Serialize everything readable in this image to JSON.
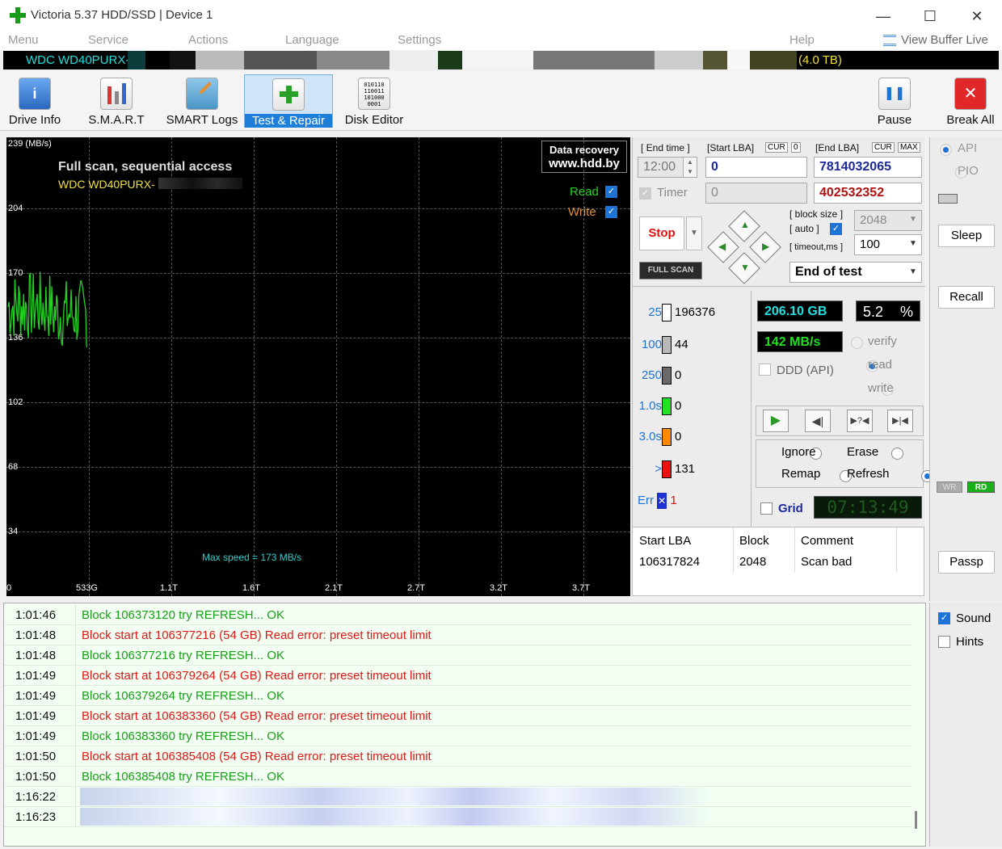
{
  "window": {
    "title": "Victoria 5.37 HDD/SSD | Device 1",
    "minimize": "—",
    "maximize": "☐",
    "close": "✕"
  },
  "menu": {
    "items": [
      "Menu",
      "Service",
      "Actions",
      "Language",
      "Settings",
      "Help"
    ],
    "view_buffer": "View Buffer Live"
  },
  "drive": {
    "name": "WDC WD40PURX-",
    "capacity": "(4.0 TB)"
  },
  "toolbar": {
    "drive_info": "Drive Info",
    "smart": "S.M.A.R.T",
    "smart_logs": "SMART Logs",
    "test_repair": "Test & Repair",
    "disk_editor": "Disk Editor",
    "pause": "Pause",
    "break_all": "Break All",
    "disk_editor_icon_text": "010110 110011 101000 0001"
  },
  "graph": {
    "y_unit": "239 (MB/s)",
    "y_ticks": [
      "204",
      "170",
      "136",
      "102",
      "68",
      "34"
    ],
    "x_ticks": [
      "0",
      "533G",
      "1.1T",
      "1.6T",
      "2.1T",
      "2.7T",
      "3.2T",
      "3.7T"
    ],
    "title": "Full scan, sequential access",
    "drive": "WDC WD40PURX-",
    "brand_line1": "Data recovery",
    "brand_line2": "www.hdd.by",
    "read_label": "Read",
    "write_label": "Write",
    "max_speed": "Max speed = 173 MB/s",
    "read_color": "#22d422",
    "write_color": "#e09040"
  },
  "controls": {
    "end_time_label": "[ End time ]",
    "start_lba_label": "[Start LBA]",
    "end_lba_label": "[End LBA]",
    "cur_tag": "CUR",
    "max_tag": "MAX",
    "start_cur_value": "0",
    "end_time": "12:00",
    "start_lba": "0",
    "end_lba": "7814032065",
    "timer_label": "Timer",
    "timer_value": "0",
    "current_lba": "402532352",
    "stop": "Stop",
    "full_scan": "FULL SCAN",
    "block_size_label": "[ block size ]",
    "auto_label": "[ auto ]",
    "timeout_label": "[ timeout,ms ]",
    "block_size": "2048",
    "timeout": "100",
    "end_action": "End of test"
  },
  "stats": {
    "rows": [
      {
        "label": "25",
        "count": "196376",
        "color": "#ffffff"
      },
      {
        "label": "100",
        "count": "44",
        "color": "#b8b8b8"
      },
      {
        "label": "250",
        "count": "0",
        "color": "#6a6a6a"
      },
      {
        "label": "1.0s",
        "count": "0",
        "color": "#22e022"
      },
      {
        "label": "3.0s",
        "count": "0",
        "color": "#ff8a00"
      },
      {
        "label": ">",
        "count": "131",
        "color": "#ee1010"
      }
    ],
    "err_label": "Err",
    "err_count": "1",
    "size": "206.10 GB",
    "percent": "5.2",
    "percent_sign": "%",
    "speed": "142 MB/s",
    "ddd": "DDD (API)",
    "verify": "verify",
    "read": "read",
    "write": "write",
    "ignore": "Ignore",
    "erase": "Erase",
    "remap": "Remap",
    "refresh": "Refresh",
    "grid": "Grid",
    "clock": "07:13:49"
  },
  "result": {
    "headers": [
      "Start LBA",
      "Block",
      "Comment"
    ],
    "row": [
      "106317824",
      "2048",
      "Scan bad"
    ]
  },
  "side": {
    "api": "API",
    "pio": "PIO",
    "sleep": "Sleep",
    "recall": "Recall",
    "wr": "WR",
    "rd": "RD",
    "passp": "Passp"
  },
  "log": [
    {
      "time": "1:01:46",
      "msg": "Block 106373120 try REFRESH... OK",
      "type": "ok"
    },
    {
      "time": "1:01:48",
      "msg": "Block start at 106377216 (54 GB) Read error: preset timeout limit",
      "type": "err"
    },
    {
      "time": "1:01:48",
      "msg": "Block 106377216 try REFRESH... OK",
      "type": "ok"
    },
    {
      "time": "1:01:49",
      "msg": "Block start at 106379264 (54 GB) Read error: preset timeout limit",
      "type": "err"
    },
    {
      "time": "1:01:49",
      "msg": "Block 106379264 try REFRESH... OK",
      "type": "ok"
    },
    {
      "time": "1:01:49",
      "msg": "Block start at 106383360 (54 GB) Read error: preset timeout limit",
      "type": "err"
    },
    {
      "time": "1:01:49",
      "msg": "Block 106383360 try REFRESH... OK",
      "type": "ok"
    },
    {
      "time": "1:01:50",
      "msg": "Block start at 106385408 (54 GB) Read error: preset timeout limit",
      "type": "err"
    },
    {
      "time": "1:01:50",
      "msg": "Block 106385408 try REFRESH... OK",
      "type": "ok"
    },
    {
      "time": "1:16:22",
      "msg": "",
      "type": "blur"
    },
    {
      "time": "1:16:23",
      "msg": "",
      "type": "blur"
    }
  ],
  "options": {
    "sound": "Sound",
    "hints": "Hints"
  }
}
